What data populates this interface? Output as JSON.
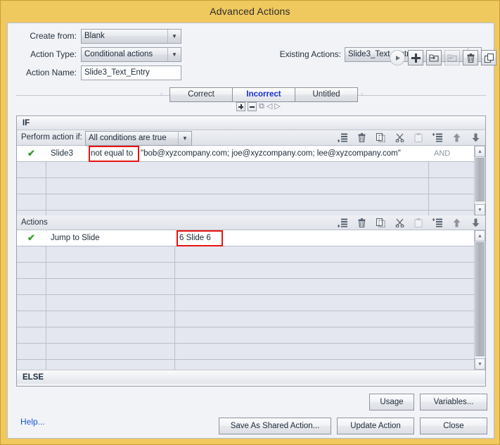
{
  "window": {
    "title": "Advanced Actions",
    "titlebar_color": "#efc85e",
    "accent_color": "#1a2ed2",
    "highlight_box_color": "#e81313"
  },
  "form": {
    "create_from": {
      "label": "Create from:",
      "value": "Blank"
    },
    "action_type": {
      "label": "Action Type:",
      "value": "Conditional actions"
    },
    "action_name": {
      "label": "Action Name:",
      "value": "Slide3_Text_Entry"
    },
    "existing_actions": {
      "label": "Existing Actions:",
      "value": "Slide3_Text_Entry"
    }
  },
  "toolbar": {
    "icons": [
      {
        "name": "preview-icon",
        "glyph": "▶",
        "disabled": false
      },
      {
        "name": "add-action-icon",
        "glyph": "✚",
        "disabled": false
      },
      {
        "name": "save-as-shared-icon",
        "glyph": "❐",
        "disabled": false
      },
      {
        "name": "import-shared-icon",
        "glyph": "❐",
        "disabled": true
      },
      {
        "name": "delete-action-icon",
        "glyph": "Ὕ1",
        "disabled": false
      },
      {
        "name": "duplicate-action-icon",
        "glyph": "⧉",
        "disabled": false
      }
    ]
  },
  "tabs": {
    "items": [
      {
        "label": "Correct",
        "active": false
      },
      {
        "label": "Incorrect",
        "active": true
      },
      {
        "label": "Untitled",
        "active": false
      }
    ],
    "prev_arrow": "‹",
    "next_arrow": "›",
    "tools": [
      {
        "name": "add-tab-button",
        "glyph": "+"
      },
      {
        "name": "remove-tab-button",
        "glyph": "−"
      },
      {
        "name": "duplicate-tab-button",
        "glyph": "⧉"
      },
      {
        "name": "previous-tab-button",
        "glyph": "◁"
      },
      {
        "name": "next-tab-button",
        "glyph": "▷"
      }
    ]
  },
  "if_section": {
    "header": "IF",
    "perform_label": "Perform action if:",
    "perform_value": "All conditions are true",
    "row_tools": [
      {
        "name": "add-condition-icon",
        "glyph": "≡",
        "disabled": false
      },
      {
        "name": "delete-condition-icon",
        "glyph": "🗑",
        "disabled": false
      },
      {
        "name": "copy-condition-icon",
        "glyph": "⧉",
        "disabled": false
      },
      {
        "name": "cut-condition-icon",
        "glyph": "✂",
        "disabled": false
      },
      {
        "name": "paste-condition-icon",
        "glyph": "▣",
        "disabled": true
      },
      {
        "name": "insert-condition-icon",
        "glyph": "≡",
        "disabled": false
      },
      {
        "name": "move-up-icon",
        "glyph": "⬆",
        "disabled": false
      },
      {
        "name": "move-down-icon",
        "glyph": "⬇",
        "disabled": false
      }
    ],
    "conditions": [
      {
        "enabled_mark": "✔",
        "variable": "Slide3",
        "operator": "not equal to",
        "value": "\"bob@xyzcompany.com; joe@xyzcompany.com; lee@xyzcompany.com\"",
        "operator_highlighted": true,
        "join": "AND"
      }
    ],
    "empty_row_count": 4
  },
  "actions_section": {
    "header": "Actions",
    "row_tools": [
      {
        "name": "add-action-row-icon",
        "glyph": "≡",
        "disabled": false
      },
      {
        "name": "delete-action-row-icon",
        "glyph": "🗑",
        "disabled": false
      },
      {
        "name": "copy-action-row-icon",
        "glyph": "⧉",
        "disabled": false
      },
      {
        "name": "cut-action-row-icon",
        "glyph": "✂",
        "disabled": false
      },
      {
        "name": "paste-action-row-icon",
        "glyph": "▣",
        "disabled": true
      },
      {
        "name": "insert-action-row-icon",
        "glyph": "≡",
        "disabled": false
      },
      {
        "name": "move-up-icon",
        "glyph": "⬆",
        "disabled": false
      },
      {
        "name": "move-down-icon",
        "glyph": "⬇",
        "disabled": false
      }
    ],
    "actions": [
      {
        "enabled_mark": "✔",
        "action": "Jump to Slide",
        "target": "6 Slide 6",
        "target_highlighted": true
      }
    ],
    "empty_row_count": 8
  },
  "else_section": {
    "header": "ELSE"
  },
  "footer": {
    "usage": "Usage",
    "variables": "Variables...",
    "help": "Help...",
    "save_as_shared": "Save As Shared Action...",
    "update_action": "Update Action",
    "close": "Close"
  }
}
